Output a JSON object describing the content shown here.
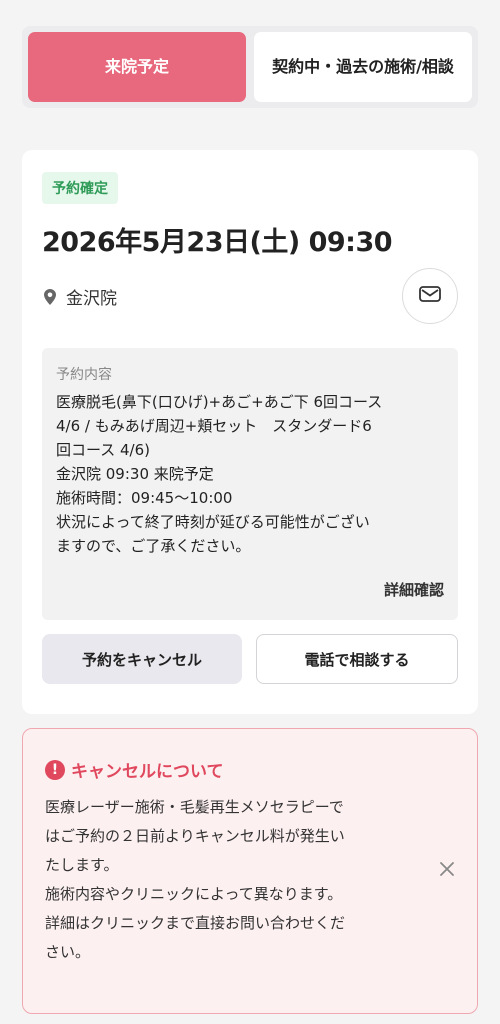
{
  "tabs": {
    "active": "来院予定",
    "inactive": "契約中・過去の施術/相談"
  },
  "reservation": {
    "status": "予約確定",
    "datetime": "2026年5月23日(土) 09:30",
    "clinic": "金沢院",
    "details_label": "予約内容",
    "details_lines": [
      "医療脱毛(鼻下(口ひげ)+あご+あご下 6回コース",
      "4/6 / もみあげ周辺+頬セット　スタンダード6",
      "回コース 4/6)",
      "金沢院 09:30 来院予定",
      "施術時間：09:45〜10:00",
      "状況によって終了時刻が延びる可能性がござい",
      "ますので、ご了承ください。"
    ],
    "details_link": "詳細確認",
    "cancel_button": "予約をキャンセル",
    "phone_button": "電話で相談する"
  },
  "notice": {
    "title": "キャンセルについて",
    "lines": [
      "医療レーザー施術・毛髪再生メソセラピーで",
      "はご予約の２日前よりキャンセル料が発生い",
      "たします。",
      "施術内容やクリニックによって異なります。",
      "詳細はクリニックまで直接お問い合わせくだ",
      "さい。"
    ]
  },
  "colors": {
    "accent": "#e8687d",
    "confirmed_bg": "#e6f7ec",
    "confirmed_text": "#2e9b57",
    "alert": "#e0485e"
  },
  "icons": [
    "map-pin-icon",
    "mail-icon",
    "alert-icon",
    "close-icon"
  ]
}
